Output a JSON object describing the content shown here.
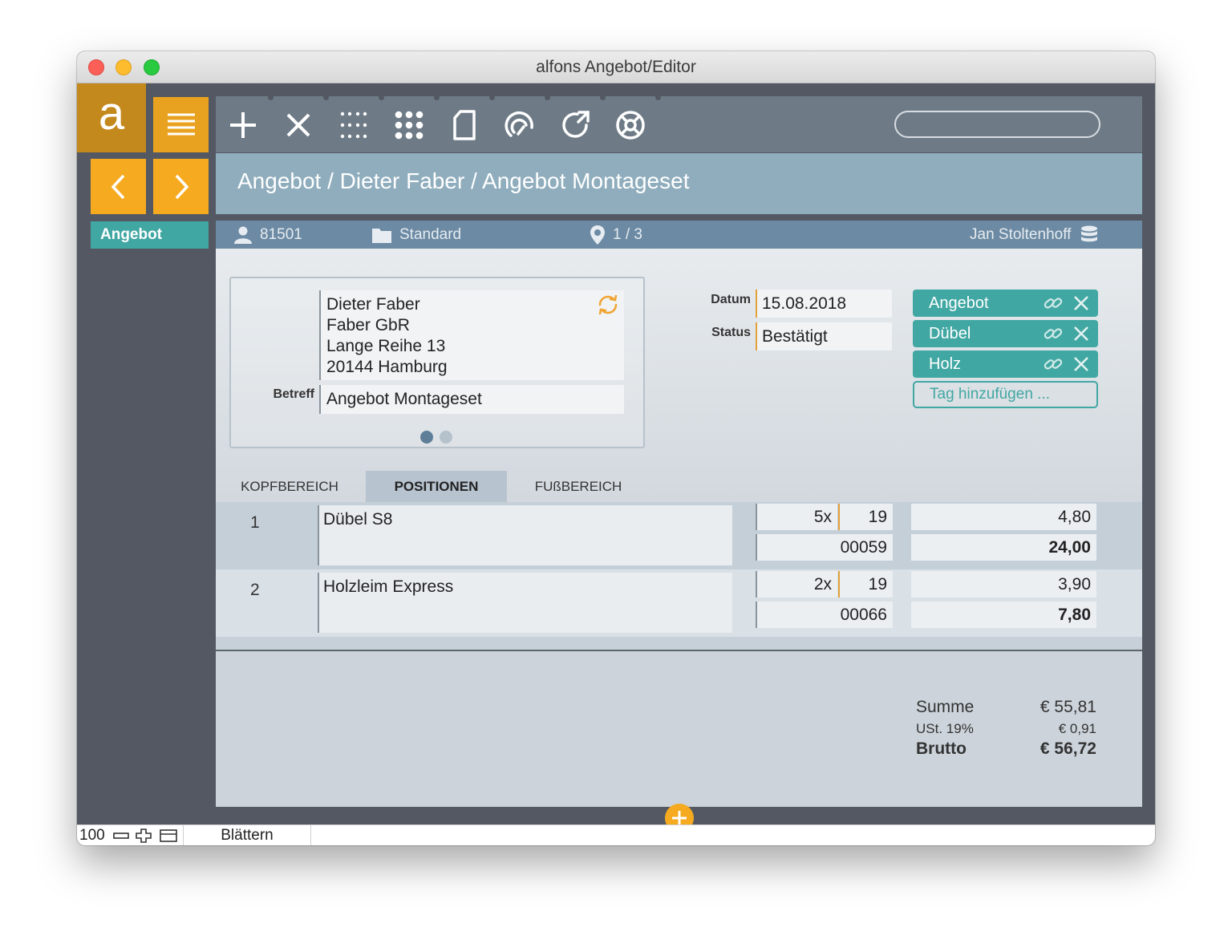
{
  "window": {
    "title": "alfons Angebot/Editor"
  },
  "sidebar": {
    "logo": "a",
    "items": [
      {
        "label": "Angebot",
        "active": true
      }
    ]
  },
  "toolbar": {
    "tools": [
      "plus-icon",
      "close-icon",
      "dot-grid-small-icon",
      "dot-grid-large-icon",
      "document-icon",
      "fingerprint-icon",
      "refresh-icon",
      "lifebuoy-icon"
    ],
    "search": {
      "value": "",
      "placeholder": ""
    }
  },
  "breadcrumb": {
    "text": "Angebot / Dieter Faber / Angebot Montageset"
  },
  "infobar": {
    "customer_number": "81501",
    "folder": "Standard",
    "record_position": "1 / 3",
    "user": "Jan Stoltenhoff"
  },
  "address": {
    "lines": [
      "Dieter Faber",
      "Faber GbR",
      "Lange Reihe 13",
      "20144 Hamburg"
    ],
    "betreff_label": "Betreff",
    "betreff": "Angebot Montageset",
    "page": 1,
    "pages": 2
  },
  "fields": {
    "datum_label": "Datum",
    "datum": "15.08.2018",
    "status_label": "Status",
    "status": "Bestätigt"
  },
  "tags": {
    "items": [
      "Angebot",
      "Dübel",
      "Holz"
    ],
    "add_label": "Tag hinzufügen ..."
  },
  "tabs": [
    {
      "label": "KOPFBEREICH",
      "active": false
    },
    {
      "label": "POSITIONEN",
      "active": true
    },
    {
      "label": "FUßBEREICH",
      "active": false
    }
  ],
  "positions": [
    {
      "num": "1",
      "desc": "Dübel S8",
      "qty": "5x",
      "vat": "19",
      "article": "00059",
      "price": "4,80",
      "total": "24,00"
    },
    {
      "num": "2",
      "desc": "Holzleim Express",
      "qty": "2x",
      "vat": "19",
      "article": "00066",
      "price": "3,90",
      "total": "7,80"
    }
  ],
  "totals": {
    "summe_label": "Summe",
    "summe": "€ 55,81",
    "ust_label": "USt. 19%",
    "ust": "€ 0,91",
    "brutto_label": "Brutto",
    "brutto": "€ 56,72"
  },
  "statusbar": {
    "zoom": "100",
    "mode": "Blättern"
  },
  "colors": {
    "accent_orange": "#f5aa20",
    "teal": "#41a7a3",
    "breadcrumb_bg": "#8fadbd",
    "infobar_bg": "#6c8aa3"
  }
}
